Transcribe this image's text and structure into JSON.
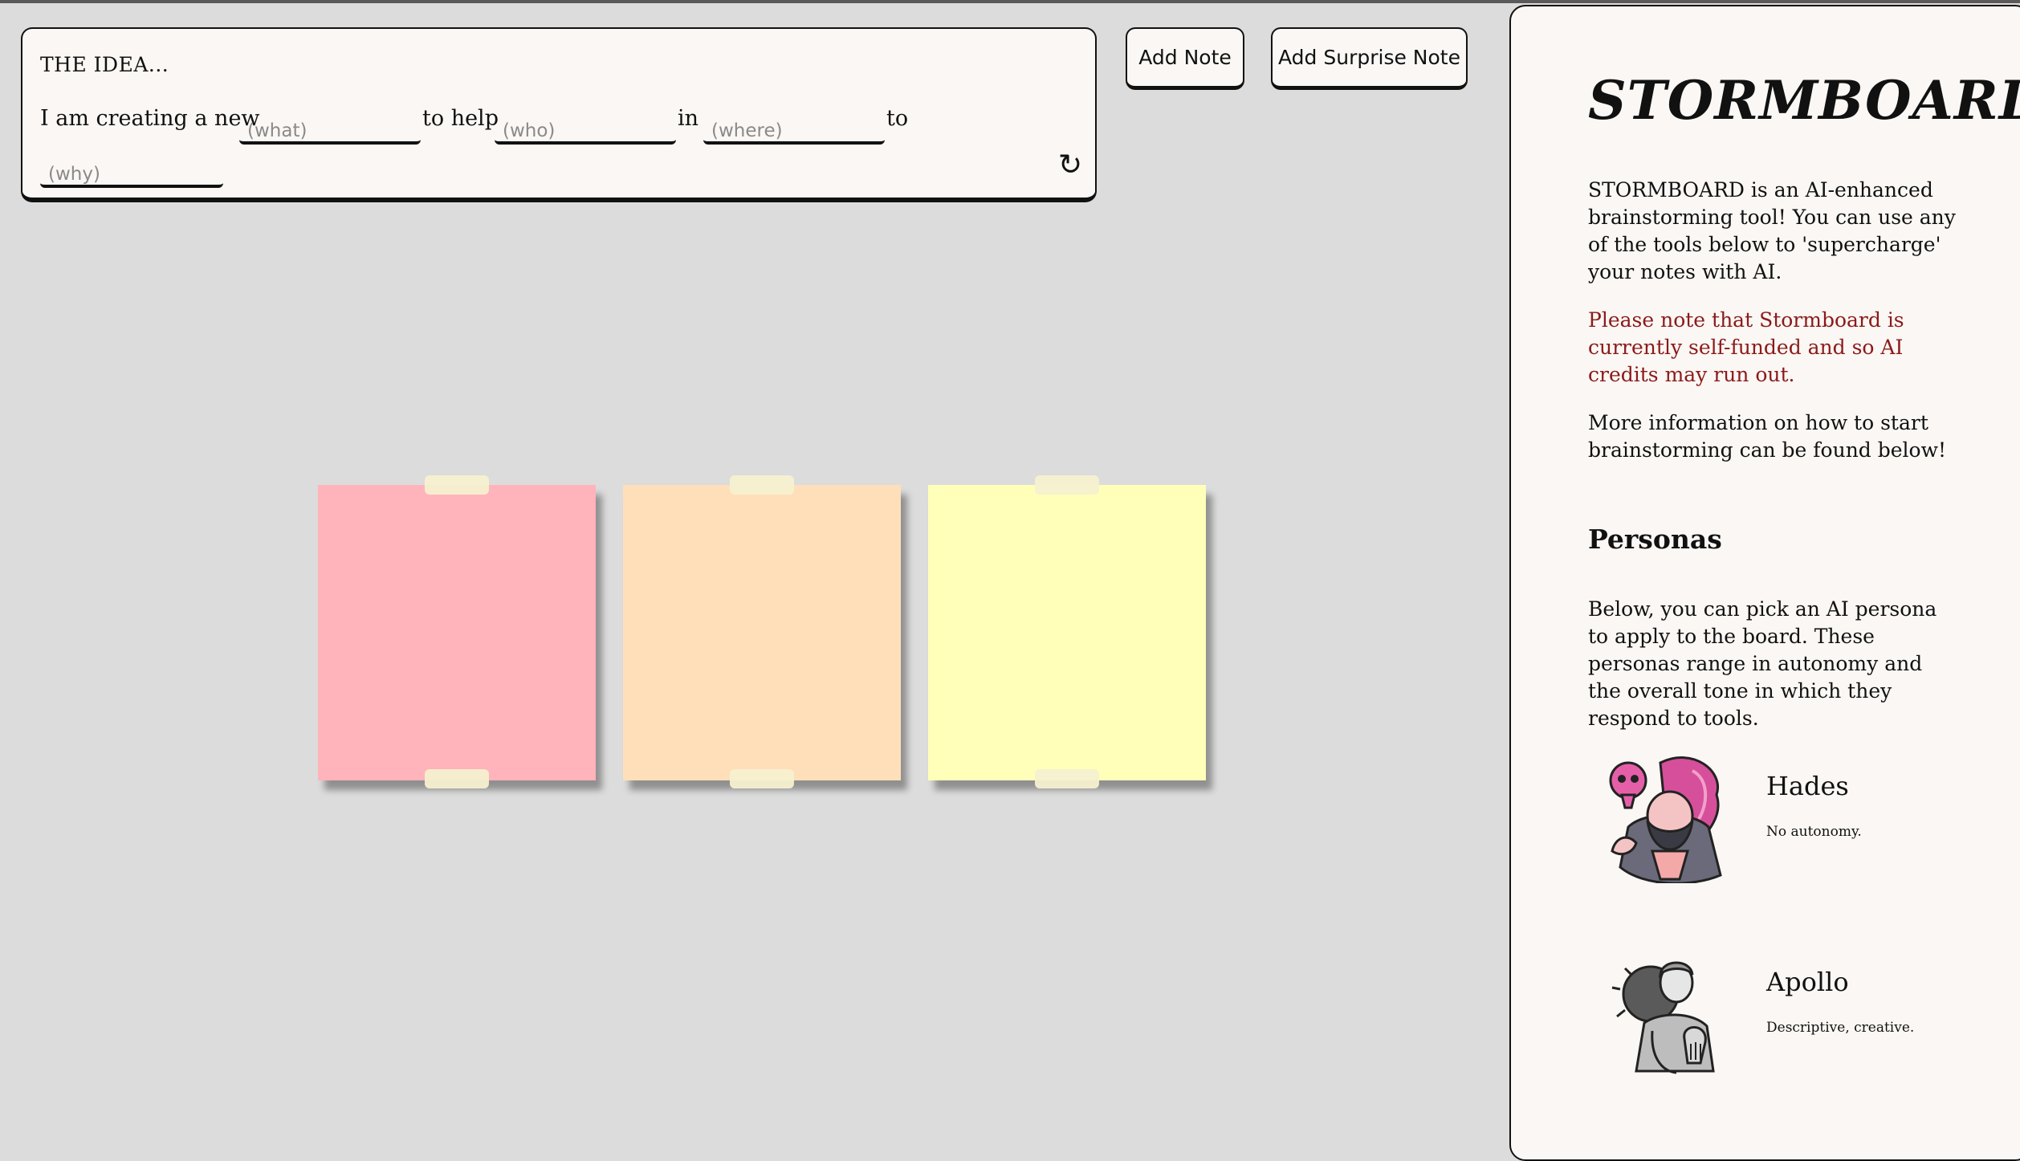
{
  "idea": {
    "heading": "THE IDEA...",
    "prefix": "I am creating a new",
    "what_placeholder": "(what)",
    "to_help": "to help",
    "who_placeholder": "(who)",
    "in_text": "in",
    "where_placeholder": "(where)",
    "to_text": "to",
    "why_placeholder": "(why)",
    "refresh_glyph": "↻"
  },
  "toolbar": {
    "add_note_label": "Add Note",
    "add_surprise_note_label": "Add Surprise Note"
  },
  "notes": [
    {
      "color": "#ffb3ba"
    },
    {
      "color": "#ffdfba"
    },
    {
      "color": "#ffffba"
    }
  ],
  "panel": {
    "title": "STORMBOARD",
    "intro": "STORMBOARD is an AI-enhanced brainstorming tool! You can use any of the tools below to 'supercharge' your notes with AI.",
    "warning": "Please note that Stormboard is currently self-funded and so AI credits may run out.",
    "more_info": "More information on how to start brainstorming can be found below!",
    "personas_heading": "Personas",
    "personas_intro": "Below, you can pick an AI persona to apply to the board. These personas range in autonomy and the overall tone in which they respond to tools.",
    "personas": [
      {
        "name": "Hades",
        "description": "No autonomy.",
        "icon": "hades-avatar-icon"
      },
      {
        "name": "Apollo",
        "description": "Descriptive, creative.",
        "icon": "apollo-avatar-icon"
      }
    ]
  },
  "colors": {
    "background": "#dcdcdc",
    "panel_background": "#faf7f4",
    "warning_text": "#8b1a1a",
    "tape": "#f6f0cf"
  }
}
